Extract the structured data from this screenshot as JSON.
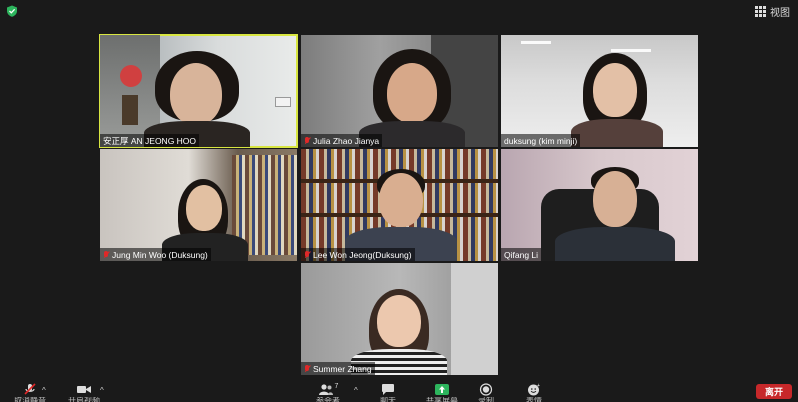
{
  "header": {
    "view_label": "视图"
  },
  "participants": [
    {
      "name": "安正厚  AN JEONG HOO",
      "muted": false,
      "active": true
    },
    {
      "name": "Julia Zhao Jianya",
      "muted": true,
      "active": false
    },
    {
      "name": "duksung (kim minji)",
      "muted": false,
      "active": false
    },
    {
      "name": "Jung Min Woo (Duksung)",
      "muted": true,
      "active": false
    },
    {
      "name": "Lee Won Jeong(Duksung)",
      "muted": true,
      "active": false
    },
    {
      "name": "Qifang Li",
      "muted": false,
      "active": false
    },
    {
      "name": "Summer Zhang",
      "muted": true,
      "active": false
    }
  ],
  "toolbar": {
    "mute_label": "取消静音",
    "video_label": "开启视频",
    "participants_label": "参会者",
    "participants_count": "7",
    "chat_label": "聊天",
    "share_label": "共享屏幕",
    "record_label": "录制",
    "reactions_label": "表情",
    "leave_label": "离开"
  },
  "colors": {
    "active_border": "#d8e641",
    "leave": "#c7282a",
    "share": "#2db55d"
  }
}
